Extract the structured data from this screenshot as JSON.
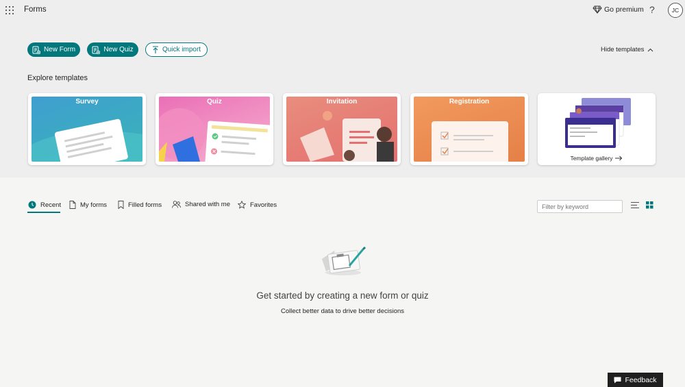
{
  "header": {
    "app_title": "Forms",
    "go_premium": "Go premium",
    "help": "?",
    "avatar_initials": "JC"
  },
  "actions": {
    "new_form": "New Form",
    "new_quiz": "New Quiz",
    "quick_import": "Quick import",
    "hide_templates": "Hide templates"
  },
  "templates": {
    "heading": "Explore templates",
    "items": [
      {
        "label": "Survey"
      },
      {
        "label": "Quiz"
      },
      {
        "label": "Invitation"
      },
      {
        "label": "Registration"
      }
    ],
    "gallery_label": "Template gallery"
  },
  "tabs": [
    {
      "label": "Recent",
      "icon": "clock-icon",
      "selected": true
    },
    {
      "label": "My forms",
      "icon": "document-icon"
    },
    {
      "label": "Filled forms",
      "icon": "bookmark-icon"
    },
    {
      "label": "Shared with me",
      "icon": "people-icon"
    },
    {
      "label": "Favorites",
      "icon": "star-icon"
    }
  ],
  "filter": {
    "placeholder": "Filter by keyword"
  },
  "empty_state": {
    "title": "Get started by creating a new form or quiz",
    "subtitle": "Collect better data to drive better decisions"
  },
  "feedback": {
    "label": "Feedback"
  },
  "colors": {
    "accent": "#03787c",
    "survey": "#3a9fc9",
    "quiz": "#e66fb7",
    "invitation": "#e07a7a",
    "registration": "#e8834c"
  }
}
